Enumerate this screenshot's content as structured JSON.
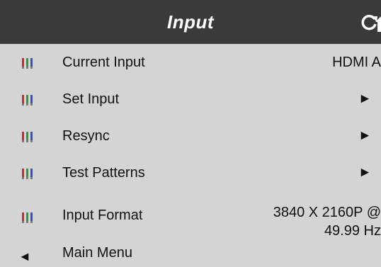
{
  "header": {
    "title": "Input",
    "refresh_icon": "refresh-icon",
    "home_icon": "home-icon",
    "background": "#3a3a3a"
  },
  "menu": {
    "current_input": {
      "label": "Current Input",
      "value": "HDMI A",
      "icon": "input-connector-icon"
    },
    "set_input": {
      "label": "Set Input",
      "arrow": "►",
      "icon": "input-connector-icon"
    },
    "resync": {
      "label": "Resync",
      "arrow": "►",
      "icon": "input-connector-icon"
    },
    "test_patterns": {
      "label": "Test Patterns",
      "arrow": "►",
      "icon": "input-connector-icon"
    },
    "input_format": {
      "label": "Input Format",
      "value_line1": "3840 X 2160P @",
      "value_line2": "49.99 Hz",
      "icon": "input-connector-icon"
    },
    "main_menu": {
      "label": "Main Menu",
      "arrow": "◄"
    }
  },
  "colors": {
    "background": "#d4d4d4",
    "connector_red": "#d12a2a",
    "connector_green": "#2f9a3a",
    "connector_blue": "#2f4fd0"
  }
}
